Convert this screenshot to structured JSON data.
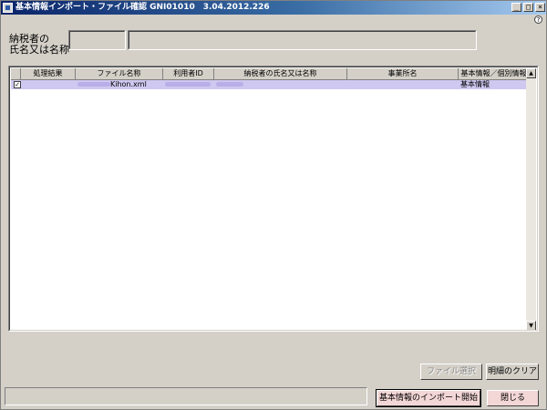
{
  "window": {
    "title": "基本情報インポート・ファイル確認 GNI01010　3.04.2012.226",
    "buttons": {
      "minimize": "_",
      "maximize": "□",
      "close": "×"
    },
    "help_glyph": "?"
  },
  "header": {
    "taxpayer_label_line1": "納税者の",
    "taxpayer_label_line2": "氏名又は名称",
    "taxpayer_code_value": "",
    "taxpayer_name_value": ""
  },
  "table": {
    "columns": [
      "処理結果",
      "ファイル名称",
      "利用者ID",
      "納税者の氏名又は名称",
      "事業所名",
      "基本情報／個別情報"
    ],
    "rows": [
      {
        "checked": true,
        "check_glyph": "✓",
        "result": "",
        "file_name": "Kihon.xml",
        "user_id": "",
        "taxpayer_name": "",
        "office_name": "",
        "info_type": "基本情報"
      }
    ],
    "scroll_up": "▲",
    "scroll_down": "▼"
  },
  "buttons": {
    "select_file": "ファイル選択",
    "clear_details": "明細のクリア",
    "start_import": "基本情報のインポート開始",
    "close": "閉じる"
  },
  "status_text": ""
}
